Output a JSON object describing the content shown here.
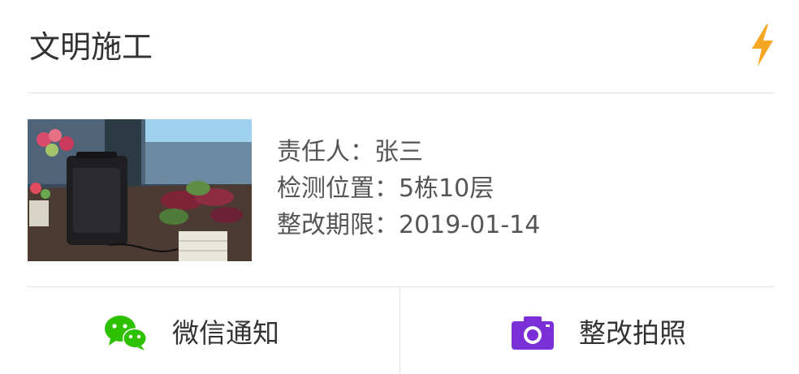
{
  "card": {
    "title": "文明施工",
    "status_icon": "lightning-bolt-icon",
    "accent_color": "#f5a623"
  },
  "details": {
    "rows": [
      {
        "label": "责任人：",
        "value": "张三"
      },
      {
        "label": "检测位置：",
        "value": "5栋10层"
      },
      {
        "label": "整改期限：",
        "value": "2019-01-14"
      }
    ]
  },
  "actions": {
    "wechat": {
      "label": "微信通知",
      "icon": "wechat-icon",
      "color": "#2dc100"
    },
    "photo": {
      "label": "整改拍照",
      "icon": "camera-icon",
      "color": "#7b2fd6"
    }
  }
}
